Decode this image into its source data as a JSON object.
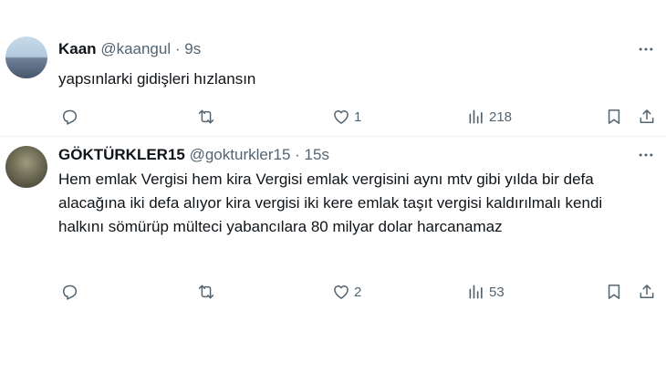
{
  "tweets": [
    {
      "name": "Kaan",
      "handle": "@kaangul",
      "dot": "·",
      "time": "9s",
      "text": "yapsınlarki gidişleri hızlansın",
      "reply_count": "",
      "retweet_count": "",
      "like_count": "1",
      "view_count": "218"
    },
    {
      "name": "GÖKTÜRKLER15",
      "handle": "@gokturkler15",
      "dot": "·",
      "time": "15s",
      "text": "Hem emlak Vergisi hem kira Vergisi emlak vergisini aynı mtv gibi yılda bir defa alacağına iki defa alıyor kira vergisi iki kere emlak taşıt vergisi kaldırılmalı kendi halkını sömürüp mülteci yabancılara 80 milyar dolar harcanamaz",
      "reply_count": "",
      "retweet_count": "",
      "like_count": "2",
      "view_count": "53"
    }
  ],
  "colors": {
    "text": "#0f1419",
    "secondary": "#536471",
    "divider": "#eff3f4"
  },
  "icons": [
    "reply-icon",
    "retweet-icon",
    "like-icon",
    "views-icon",
    "bookmark-icon",
    "share-icon",
    "more-icon"
  ]
}
